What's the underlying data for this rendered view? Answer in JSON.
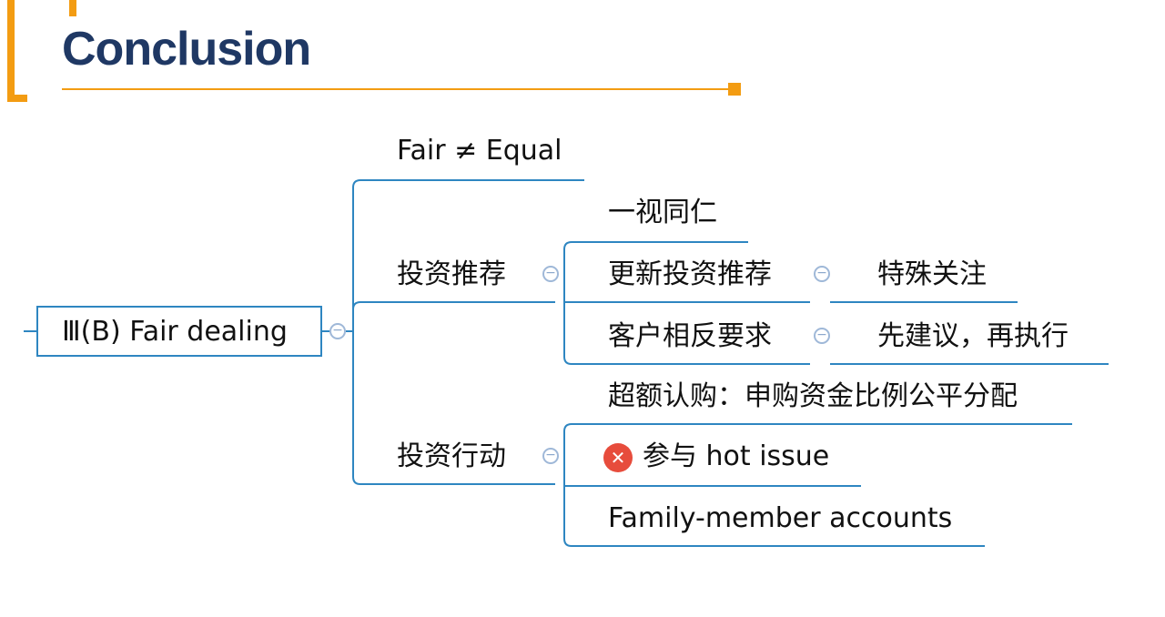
{
  "slide": {
    "title": "Conclusion"
  },
  "mindmap": {
    "root": "Ⅲ(B) Fair dealing",
    "fair_not_equal": "Fair ≠ Equal",
    "invest_rec": {
      "label": "投资推荐",
      "children": [
        {
          "label": "一视同仁"
        },
        {
          "label": "更新投资推荐",
          "child": "特殊关注"
        },
        {
          "label": "客户相反要求",
          "child": "先建议，再执行"
        }
      ]
    },
    "invest_action": {
      "label": "投资行动",
      "children": [
        {
          "label": "超额认购：申购资金比例公平分配"
        },
        {
          "label": "参与 hot issue",
          "marker": "x-circle-icon"
        },
        {
          "label": "Family-member accounts"
        }
      ]
    },
    "collapse_glyph": "−",
    "x_glyph": "✕"
  },
  "colors": {
    "accent": "#f39c12",
    "title": "#1f3864",
    "line": "#2e86c1",
    "collapse": "#9fb8d8",
    "error": "#e74c3c"
  }
}
